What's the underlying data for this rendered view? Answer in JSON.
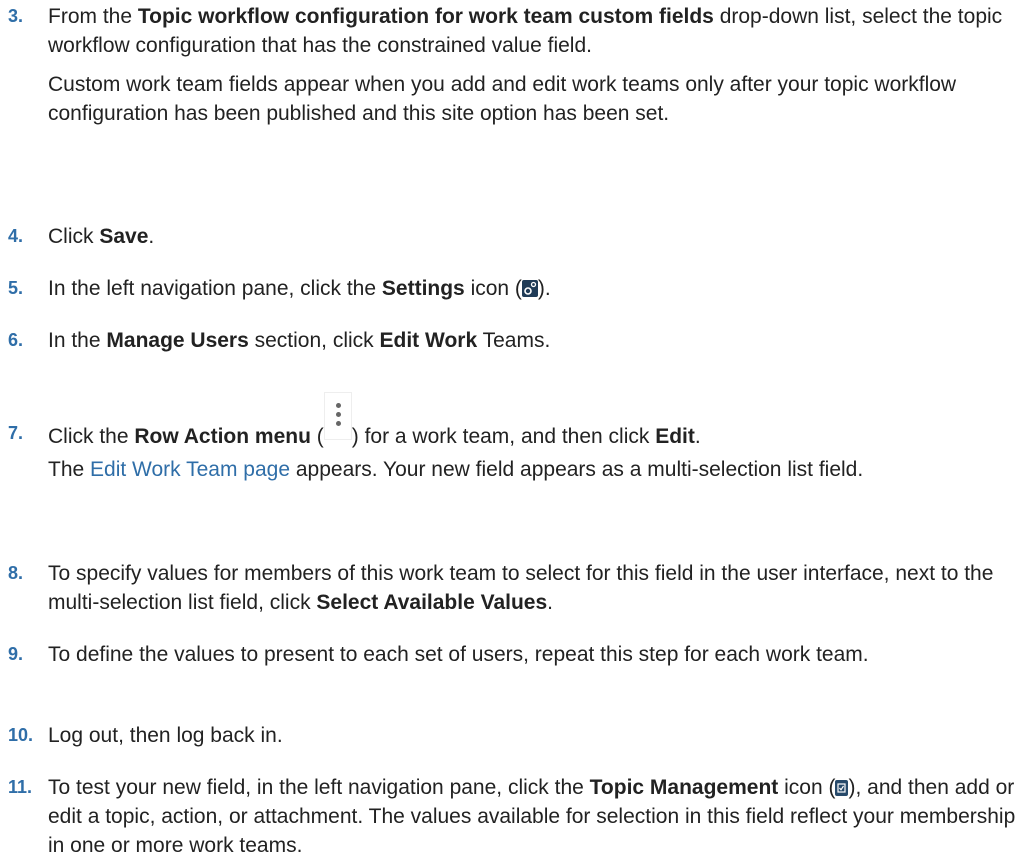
{
  "steps": [
    {
      "num": "3.",
      "p1": {
        "a": "From the ",
        "b": "Topic workflow configuration for work team custom fields",
        "c": " drop-down list, select the topic workflow configuration that has the constrained value field."
      },
      "p2": "Custom work team fields appear when you add and edit work teams only after your topic workflow configuration has been published and this site option has been set."
    },
    {
      "num": "4.",
      "a": "Click ",
      "b": "Save",
      "c": "."
    },
    {
      "num": "5.",
      "a": "In the left navigation pane, click the ",
      "b": "Settings",
      "c": " icon (",
      "d": ")."
    },
    {
      "num": "6.",
      "a": "In the ",
      "b": "Manage Users",
      "c": " section, click ",
      "d": "Edit Work",
      "e": " Teams."
    },
    {
      "num": "7.",
      "p1": {
        "a": "Click the ",
        "b": "Row Action menu",
        "c": " (",
        "d": ") for a work team, and then click ",
        "e": "Edit",
        "f": "."
      },
      "p2": {
        "a": "The ",
        "link": "Edit Work Team page",
        "b": " appears. Your new field appears as a multi-selection list field."
      }
    },
    {
      "num": "8.",
      "a": "To specify values for members of this work team to select for this field in the user interface, next to the multi-selection list field, click ",
      "b": "Select Available Values",
      "c": "."
    },
    {
      "num": "9.",
      "a": "To define the values to present to each set of users, repeat this step for each work team."
    },
    {
      "num": "10.",
      "a": "Log out, then log back in."
    },
    {
      "num": "11.",
      "a": "To test your new field, in the left navigation pane, click the ",
      "b": "Topic Management",
      "c": " icon (",
      "d": "), and then add or edit a topic, action, or attachment. The values available for selection in this field reflect your membership in one or more work teams."
    }
  ],
  "icons": {
    "settings": "settings-gear-icon",
    "row_action": "kebab-menu-icon",
    "topic_management": "topic-management-icon"
  },
  "colors": {
    "step_number": "#2f6ea8",
    "link": "#2f6ea8",
    "text": "#222222"
  }
}
